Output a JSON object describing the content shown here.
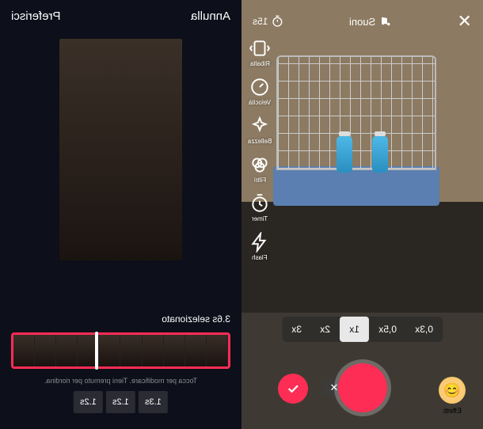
{
  "left": {
    "cancel": "Annulla",
    "prefer": "Preferisci",
    "selected": "3.6s selezionato",
    "hint": "Tocca per modificare. Tieni premuto per riordina.",
    "chips": [
      "1.2s",
      "1.2s",
      "1.3s"
    ]
  },
  "right": {
    "sounds": "Suoni",
    "duration": "15s",
    "tools": [
      {
        "id": "flip",
        "label": "Ribalta"
      },
      {
        "id": "speed",
        "label": "Velocità"
      },
      {
        "id": "beauty",
        "label": "Bellezza"
      },
      {
        "id": "filters",
        "label": "Filtri"
      },
      {
        "id": "timer",
        "label": "Timer"
      },
      {
        "id": "flash",
        "label": "Flash"
      }
    ],
    "speeds": [
      "3x",
      "2x",
      "1x",
      "0,5x",
      "0,3x"
    ],
    "active_speed": "1x",
    "effects": "Effetti"
  }
}
